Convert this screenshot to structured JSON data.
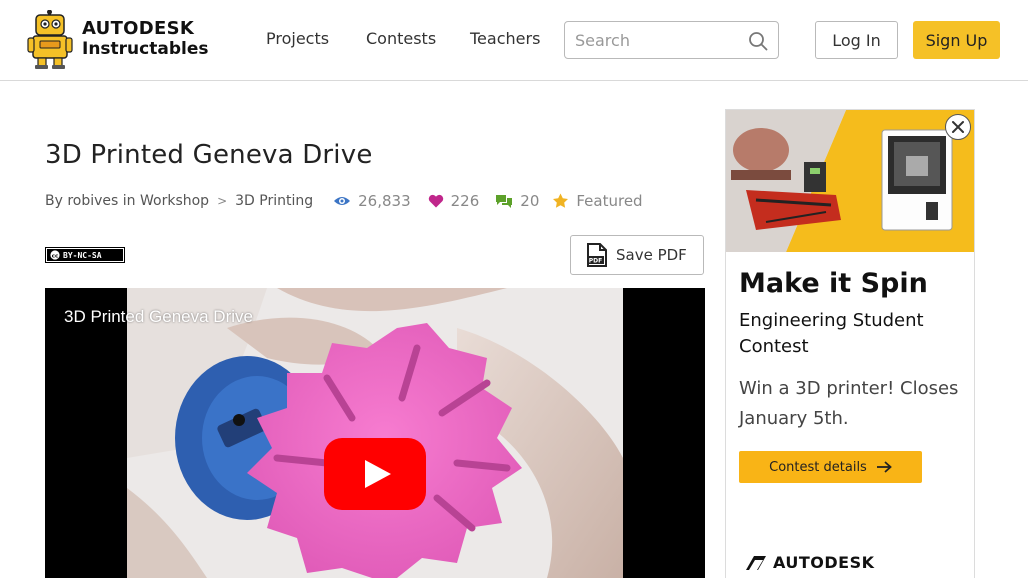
{
  "header": {
    "brand_line1": "AUTODESK",
    "brand_line2": "Instructables",
    "nav": [
      "Projects",
      "Contests",
      "Teachers"
    ],
    "search_placeholder": "Search",
    "login_label": "Log In",
    "signup_label": "Sign Up"
  },
  "article": {
    "title": "3D Printed Geneva Drive",
    "by_label": "By",
    "author": "robives",
    "in_label": "in",
    "category": "Workshop",
    "separator": ">",
    "subcategory": "3D Printing",
    "views": "26,833",
    "favorites": "226",
    "comments": "20",
    "featured_label": "Featured",
    "license_label": "BY-NC-SA",
    "save_pdf_label": "Save PDF",
    "pdf_icon_text": "PDF"
  },
  "video": {
    "title": "3D Printed Geneva Drive"
  },
  "ad": {
    "headline": "Make it Spin",
    "subhead": "Engineering Student Contest",
    "body": "Win a 3D printer! Closes January 5th.",
    "cta_label": "Contest details",
    "brand": "AUTODESK"
  },
  "colors": {
    "accent_yellow": "#f5c127",
    "cta_yellow": "#f9b416",
    "views_blue": "#3c75c5",
    "favorites_magenta": "#c0268b",
    "comments_green": "#5da12a",
    "featured_star": "#f0b323",
    "youtube_red": "#ff0000"
  },
  "icons": [
    "robot-logo-icon",
    "search-icon",
    "eye-icon",
    "heart-icon",
    "comments-icon",
    "star-icon",
    "cc-license-icon",
    "pdf-icon",
    "play-icon",
    "close-icon",
    "arrow-right-icon",
    "autodesk-logo-icon"
  ]
}
